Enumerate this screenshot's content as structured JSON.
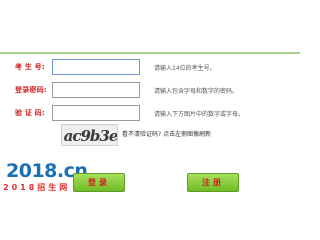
{
  "form": {
    "fields": [
      {
        "label": "考 生 号:",
        "value": "",
        "hint": "请输入14位的考生号。"
      },
      {
        "label": "登录密码:",
        "value": "",
        "hint": "请输入包含字母和数字的密码。"
      },
      {
        "label": "验 证 码:",
        "value": "",
        "hint": "请输入下方图片中的数字或字母。"
      }
    ],
    "captcha": {
      "code": "ac9b3e",
      "refresh_tip": "看不清验证码? 点击左侧图像刷新"
    }
  },
  "logo": {
    "main": "2018.cn",
    "sub": "2018招生网"
  },
  "buttons": {
    "login": "登录",
    "register": "注册"
  },
  "colors": {
    "label_red": "#d22222",
    "button_green": "#6fbb28",
    "border_green": "#a7d08b",
    "logo_blue": "#1d6fb4"
  }
}
